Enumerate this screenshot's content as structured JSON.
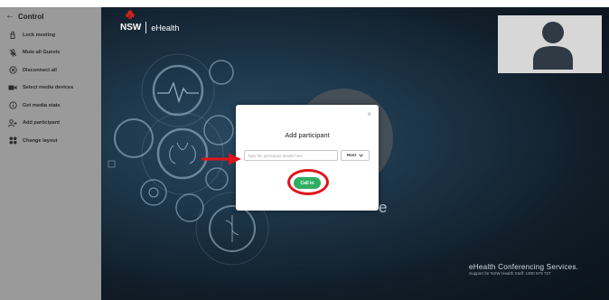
{
  "sidebar": {
    "title": "Control",
    "items": [
      {
        "label": "Lock meeting",
        "icon": "lock-icon"
      },
      {
        "label": "Mute all Guests",
        "icon": "mute-icon"
      },
      {
        "label": "Disconnect all",
        "icon": "disconnect-icon"
      },
      {
        "label": "Select media devices",
        "icon": "camera-icon"
      },
      {
        "label": "Get media stats",
        "icon": "info-icon"
      },
      {
        "label": "Add participant",
        "icon": "add-person-icon"
      },
      {
        "label": "Change layout",
        "icon": "layout-icon"
      }
    ]
  },
  "logo": {
    "primary": "NSW",
    "secondary": "eHealth"
  },
  "brand": {
    "title": "eHealth Conferencing Services.",
    "subtitle": "Support for NSW Health Staff: 1300 679 727"
  },
  "background_partial_text": "e",
  "dialog": {
    "title": "Add participant",
    "close": "×",
    "input_placeholder": "Type the participant details here",
    "input_value": "",
    "role": "Host",
    "call_label": "Call in"
  },
  "colors": {
    "accent_green": "#2fae61",
    "annotation_red": "#e0141b",
    "sidebar": "#9a9a9a",
    "stage_bg": "#152838"
  }
}
